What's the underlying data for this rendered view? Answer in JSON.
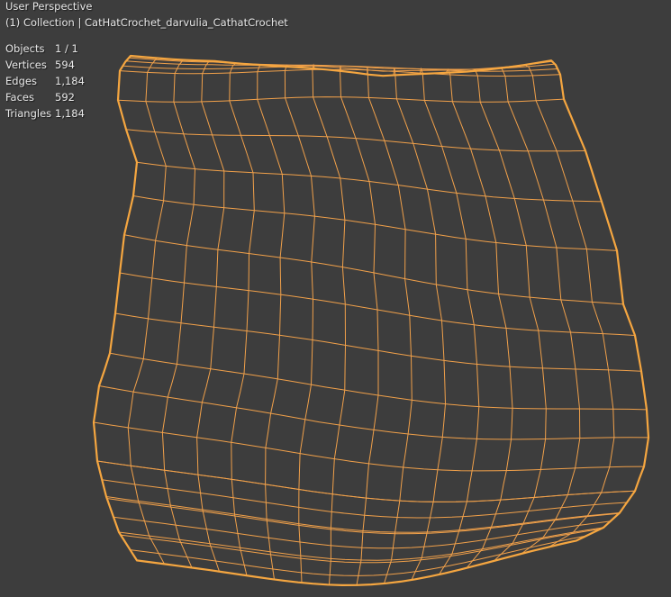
{
  "viewport": {
    "view_name": "User Perspective",
    "collection_label": "(1) Collection | CatHatCrochet_darvulia_CathatCrochet",
    "background": "#3d3d3d",
    "wire_color": "#f0a04a",
    "outline_color": "#f5a640"
  },
  "stats": [
    {
      "label": "Objects",
      "value": "1 / 1"
    },
    {
      "label": "Vertices",
      "value": "594"
    },
    {
      "label": "Edges",
      "value": "1,184"
    },
    {
      "label": "Faces",
      "value": "592"
    },
    {
      "label": "Triangles",
      "value": "1,184"
    }
  ]
}
